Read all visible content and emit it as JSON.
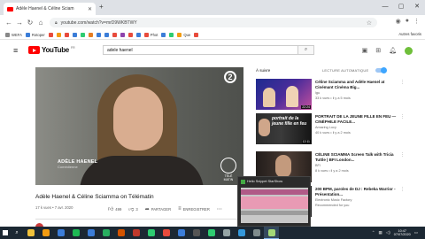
{
  "browser": {
    "tab_title": "Adèle Haenel & Céline Sciam",
    "url": "youtube.com/watch?v=mrD9WKBTWY",
    "bookmarks": [
      {
        "label": "WEFA",
        "color": "#888888"
      },
      {
        "label": "Rotoper",
        "color": "#3b7dd8"
      },
      {
        "label": "",
        "color": "#e84b3c"
      },
      {
        "label": "",
        "color": "#f39c12"
      },
      {
        "label": "",
        "color": "#e84b3c"
      },
      {
        "label": "",
        "color": "#3b7dd8"
      },
      {
        "label": "",
        "color": "#2ecc71"
      },
      {
        "label": "",
        "color": "#e67e22"
      },
      {
        "label": "",
        "color": "#3b7dd8"
      },
      {
        "label": "",
        "color": "#3b7dd8"
      },
      {
        "label": "",
        "color": "#e84b3c"
      },
      {
        "label": "",
        "color": "#8e44ad"
      },
      {
        "label": "",
        "color": "#e84b3c"
      },
      {
        "label": "",
        "color": "#3b7dd8"
      },
      {
        "label": "Phot",
        "color": "#e84b3c"
      },
      {
        "label": "",
        "color": "#3b7dd8"
      },
      {
        "label": "",
        "color": "#2ecc71"
      },
      {
        "label": "Que",
        "color": "#f39c12"
      },
      {
        "label": "",
        "color": "#e84b3c"
      }
    ],
    "bookmarks_other": "Autres favoris"
  },
  "youtube": {
    "logo_word": "YouTube",
    "logo_country": "FR",
    "search_value": "adele haenel"
  },
  "video": {
    "channel_logo": "2",
    "lower_third_name": "ADÈLE HAENEL",
    "lower_third_role": "Comédienne",
    "overlay_clock_label": "TÉLÉ MATIN",
    "title": "Adèle Haenel & Céline Sciamma on Télématin",
    "meta": "17 k vues • 7 avr. 2020",
    "likes": "499",
    "dislikes": "3",
    "share_label": "PARTAGER",
    "save_label": "ENREGISTRER"
  },
  "sidebar": {
    "up_next": "À suivre",
    "autoplay": "LECTURE AUTOMATIQUE",
    "recommendations": [
      {
        "title": "Céline Sciamma and Adèle Haenel at Cinémant Cinéma Big...",
        "channel": "lgu",
        "views": "33 k vues • il y a 5 mois",
        "duration": "22:24",
        "thumb": "th1"
      },
      {
        "title": "PORTRAIT DE LA JEUNE FILLE EN FEU — CINÉPHILE FACILE...",
        "channel": "Amazing Lucy",
        "views": "40 k vues • il y a 2 mois",
        "duration": "12:11",
        "thumb": "th2"
      },
      {
        "title": "CÉLINE SCIAMMA Screen Talk with Tricia Tuttle | BFI London...",
        "channel": "BFI",
        "views": "8 k vues • il y a 2 mois",
        "duration": "",
        "thumb": "th3"
      },
      {
        "title": "200 BPM, paroles de DJ : Rebeka Warrior - Présentation...",
        "channel": "Electronic Music Factory",
        "views": "Recommended for you",
        "duration": "",
        "thumb": "th4"
      }
    ]
  },
  "popup": {
    "title": "Hello Snippet StarShow"
  },
  "taskbar": {
    "apps": [
      {
        "color": "#f0c23b"
      },
      {
        "color": "#f39c12"
      },
      {
        "color": "#3b7dd8"
      },
      {
        "color": "#1db954"
      },
      {
        "color": "#3b7dd8"
      },
      {
        "color": "#27ae60"
      },
      {
        "color": "#d35400"
      },
      {
        "color": "#c0392b"
      },
      {
        "color": "#2ecc71"
      },
      {
        "color": "#e84b3c"
      },
      {
        "color": "#3b7dd8"
      },
      {
        "color": "#555555"
      },
      {
        "color": "#2ecc71"
      },
      {
        "color": "#95a5a6"
      },
      {
        "color": "#3498db"
      },
      {
        "color": "#7f8c8d"
      },
      {
        "color": "#a3d977"
      }
    ],
    "time": "10:47",
    "date": "07/07/2020"
  }
}
